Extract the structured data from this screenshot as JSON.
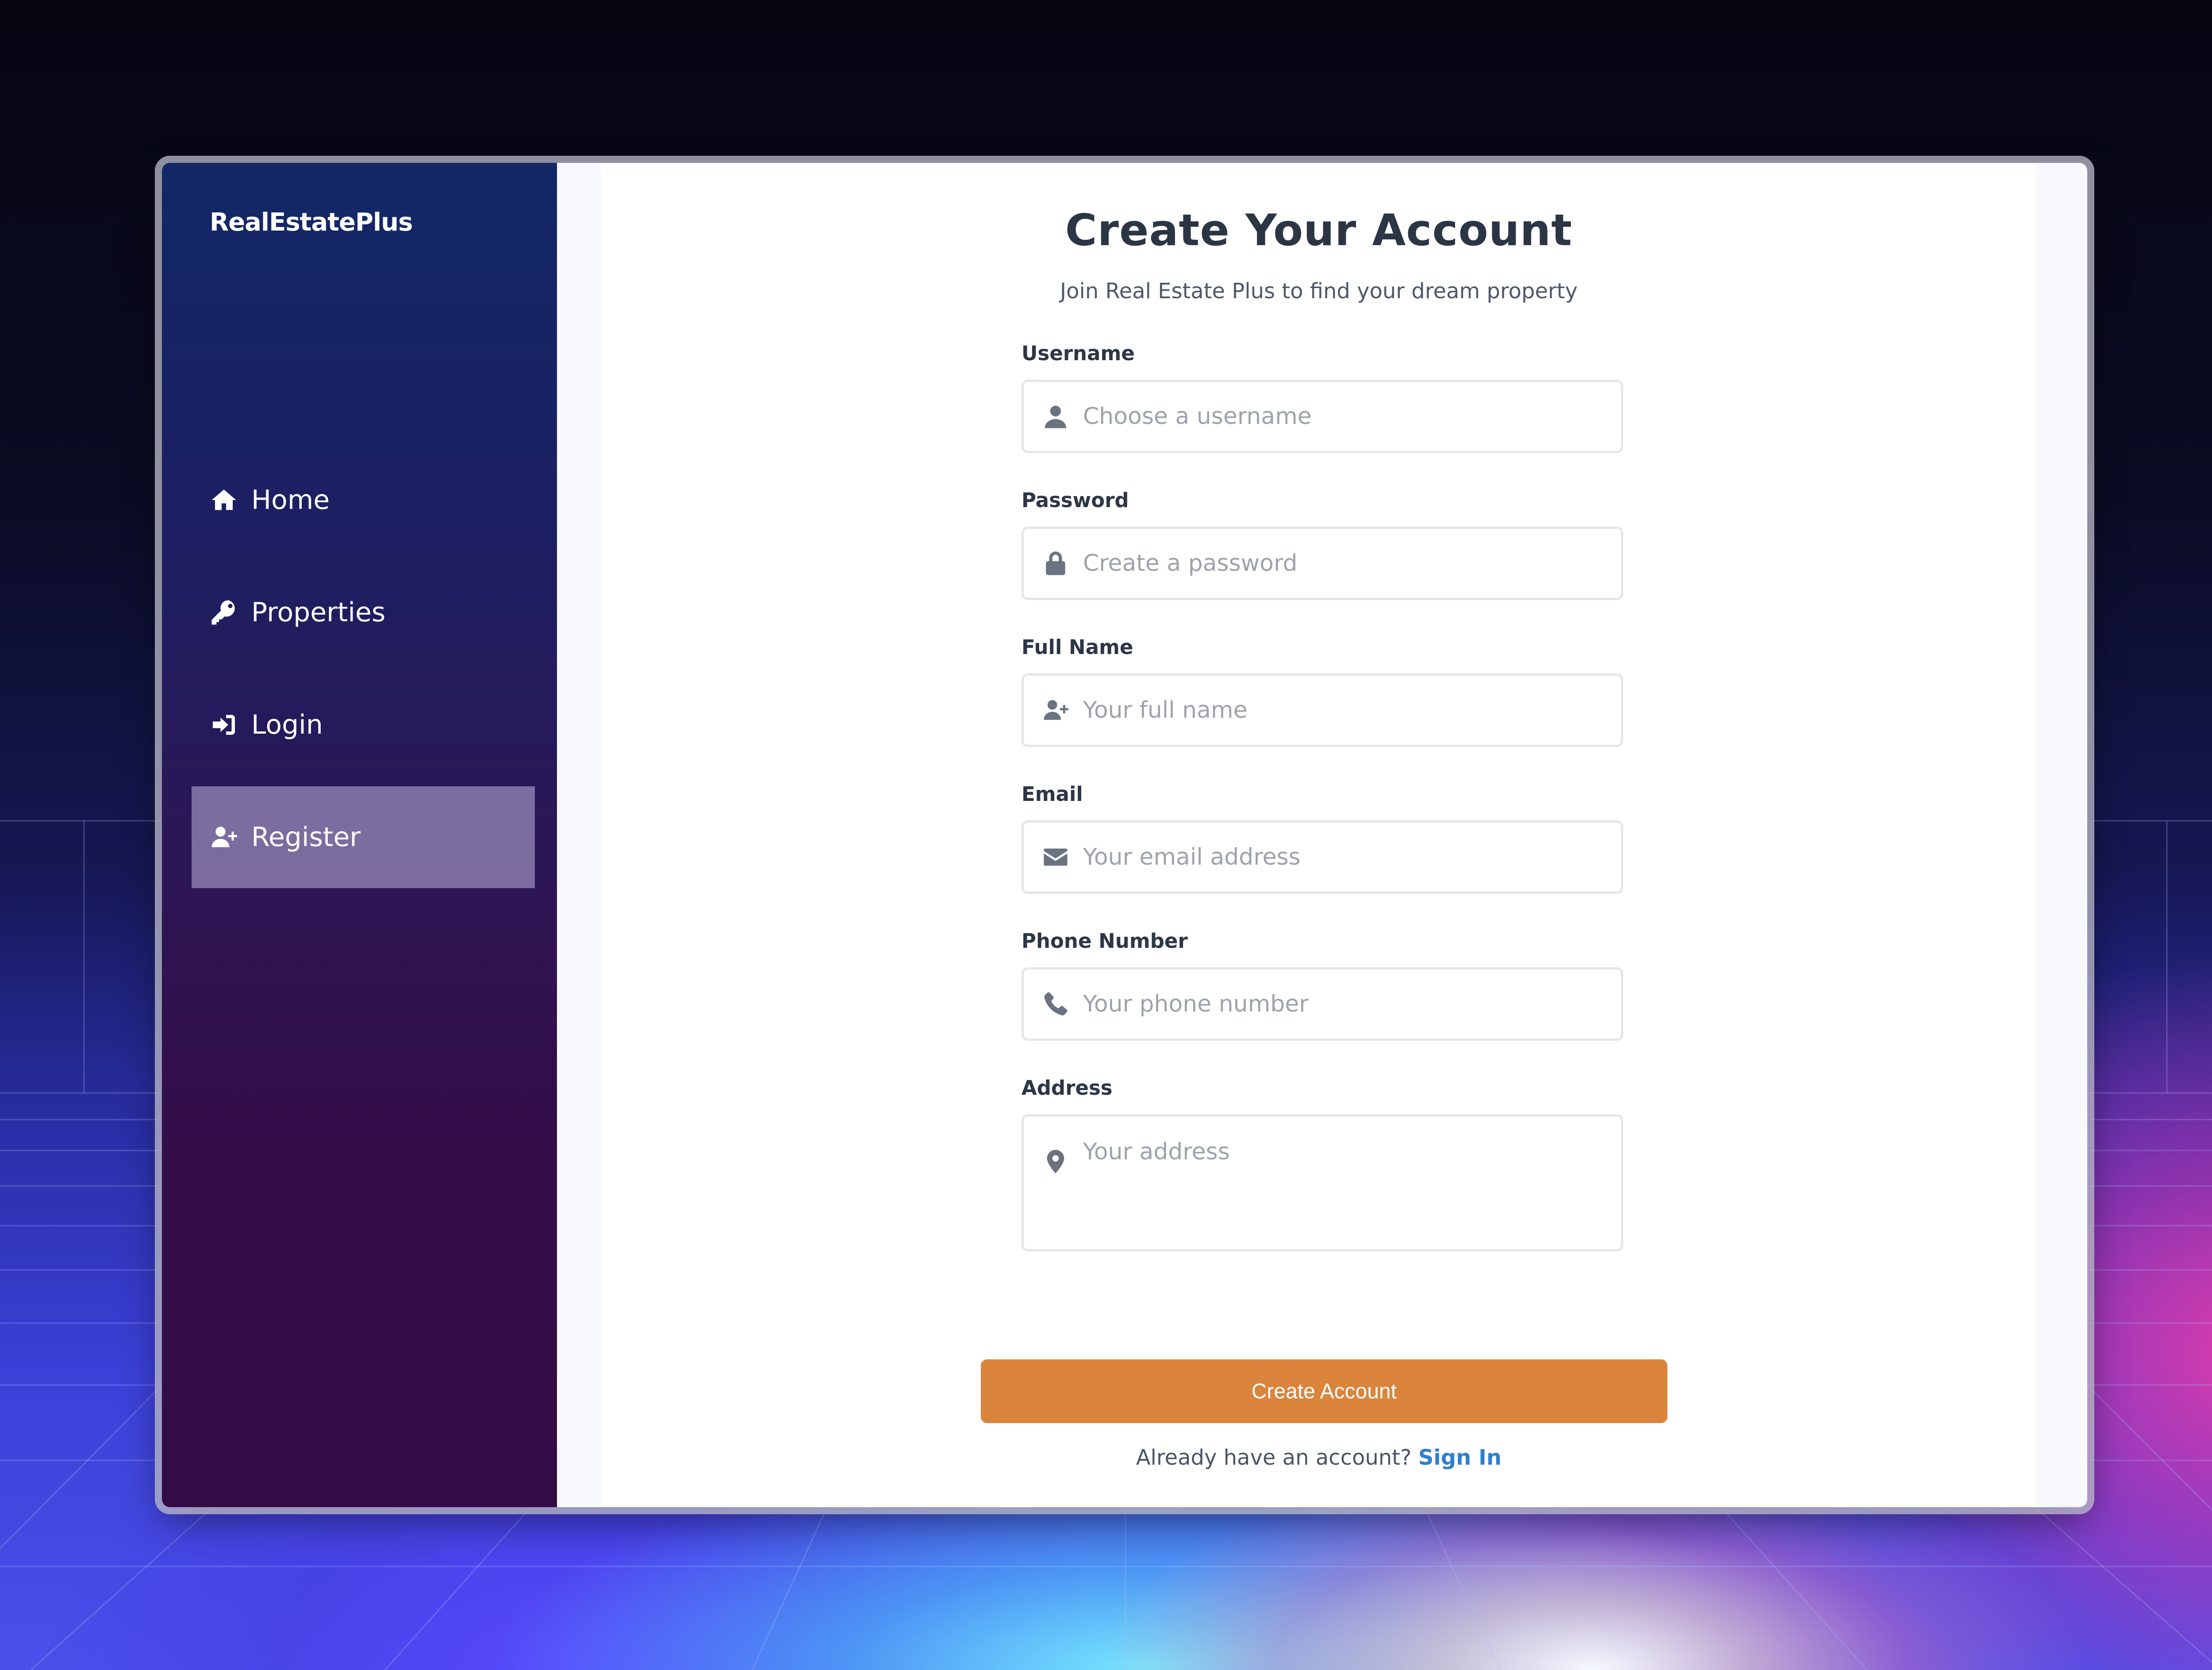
{
  "sidebar": {
    "brand": "RealEstatePlus",
    "items": [
      {
        "label": "Home",
        "icon": "home-icon"
      },
      {
        "label": "Properties",
        "icon": "key-icon"
      },
      {
        "label": "Login",
        "icon": "sign-in-icon"
      },
      {
        "label": "Register",
        "icon": "user-plus-icon",
        "active": true
      }
    ]
  },
  "form": {
    "title": "Create Your Account",
    "subtitle": "Join Real Estate Plus to find your dream property",
    "fields": [
      {
        "label": "Username",
        "placeholder": "Choose a username",
        "icon": "user-icon"
      },
      {
        "label": "Password",
        "placeholder": "Create a password",
        "icon": "lock-icon"
      },
      {
        "label": "Full Name",
        "placeholder": "Your full name",
        "icon": "user-plus-icon"
      },
      {
        "label": "Email",
        "placeholder": "Your email address",
        "icon": "envelope-icon"
      },
      {
        "label": "Phone Number",
        "placeholder": "Your phone number",
        "icon": "phone-icon"
      },
      {
        "label": "Address",
        "placeholder": "Your address",
        "icon": "map-marker-icon"
      }
    ],
    "submit_label": "Create Account",
    "signin_prompt": "Already have an account?",
    "signin_link": "Sign In"
  },
  "colors": {
    "accent": "#db843c",
    "link": "#2f7fd0",
    "active_nav": "#7a6f98",
    "sidebar_top": "#122866",
    "sidebar_bottom": "#330b45"
  }
}
